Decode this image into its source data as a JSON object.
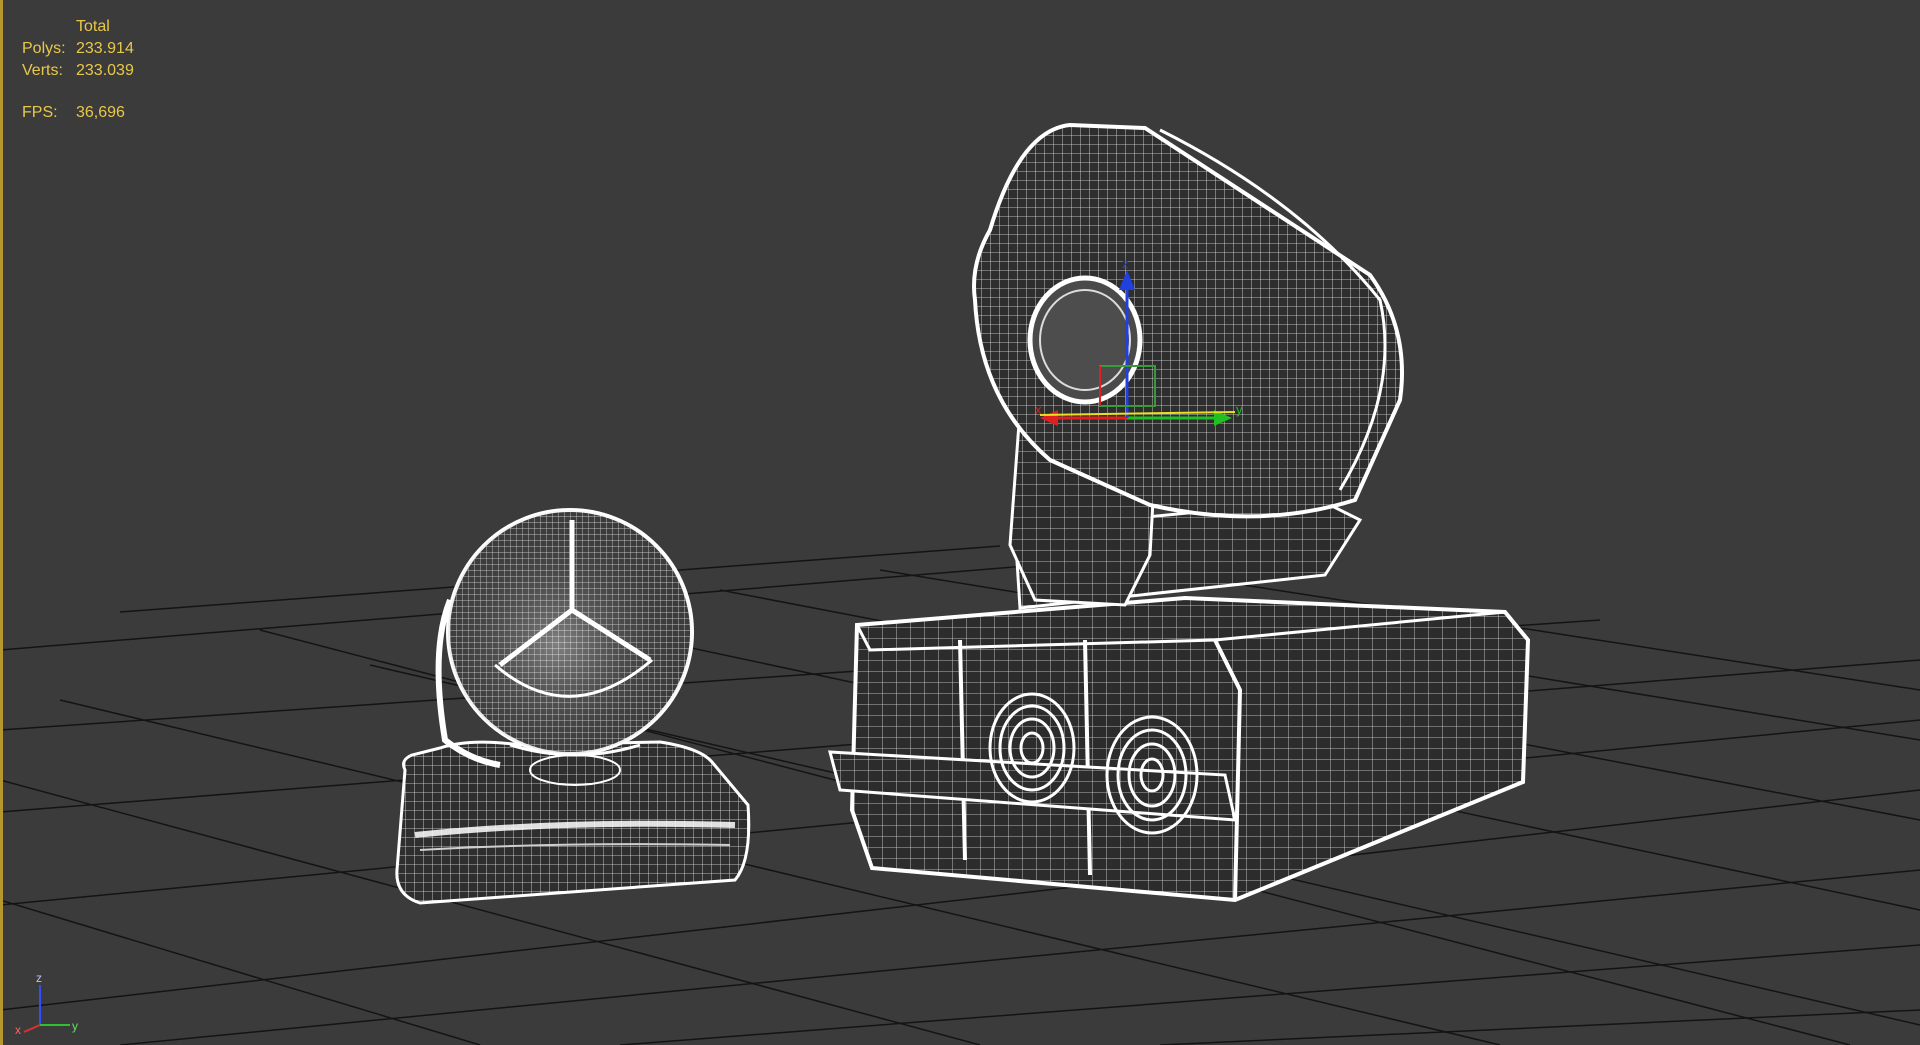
{
  "viewport": {
    "background": "#3b3b3b",
    "border_color": "#b8962e"
  },
  "stats": {
    "total_label": "Total",
    "polys_label": "Polys:",
    "polys_value": "233.914",
    "verts_label": "Verts:",
    "verts_value": "233.039",
    "fps_label": "FPS:",
    "fps_value": "36,696",
    "color": "#e8c84a"
  },
  "gizmo": {
    "x_label": "x",
    "y_label": "y",
    "z_label": "z",
    "x_color": "#e02020",
    "y_color": "#20c020",
    "z_color": "#2040e0"
  },
  "axis_tripod": {
    "x_label": "x",
    "y_label": "y",
    "z_label": "z"
  },
  "scene_objects": [
    {
      "name": "small-moving-head-light",
      "icon": "sphere-wireframe-on-base"
    },
    {
      "name": "large-moving-head-light",
      "icon": "box-head-wireframe-on-base"
    }
  ],
  "grid": {
    "color": "#111111"
  },
  "wireframe_color": "#ffffff"
}
